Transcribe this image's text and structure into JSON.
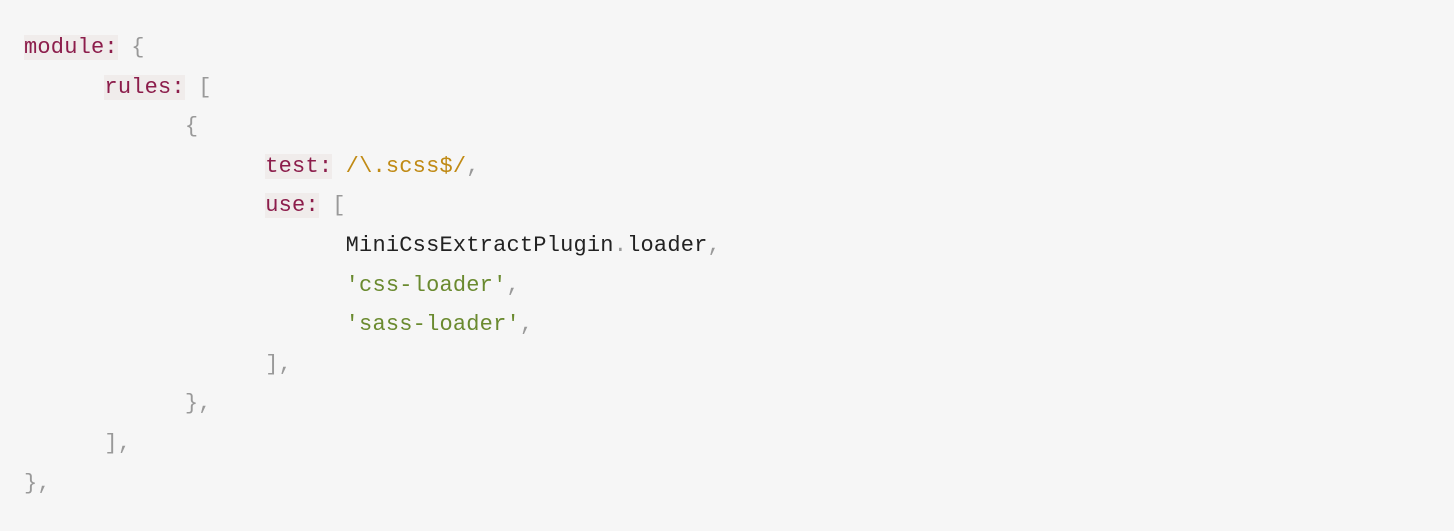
{
  "code": {
    "lines": [
      {
        "indent": 0,
        "tokens": [
          {
            "cls": "key",
            "t": "module:"
          },
          {
            "cls": "text",
            "t": " "
          },
          {
            "cls": "punct",
            "t": "{"
          }
        ]
      },
      {
        "indent": 1,
        "tokens": [
          {
            "cls": "key",
            "t": "rules:"
          },
          {
            "cls": "text",
            "t": " "
          },
          {
            "cls": "punct",
            "t": "["
          }
        ]
      },
      {
        "indent": 2,
        "tokens": [
          {
            "cls": "punct",
            "t": "{"
          }
        ]
      },
      {
        "indent": 3,
        "tokens": [
          {
            "cls": "key",
            "t": "test:"
          },
          {
            "cls": "text",
            "t": " "
          },
          {
            "cls": "regex",
            "t": "/\\.scss$/"
          },
          {
            "cls": "punct",
            "t": ","
          }
        ]
      },
      {
        "indent": 3,
        "tokens": [
          {
            "cls": "key",
            "t": "use:"
          },
          {
            "cls": "text",
            "t": " "
          },
          {
            "cls": "punct",
            "t": "["
          }
        ]
      },
      {
        "indent": 4,
        "tokens": [
          {
            "cls": "text",
            "t": "MiniCssExtractPlugin"
          },
          {
            "cls": "punct",
            "t": "."
          },
          {
            "cls": "text",
            "t": "loader"
          },
          {
            "cls": "punct",
            "t": ","
          }
        ]
      },
      {
        "indent": 4,
        "tokens": [
          {
            "cls": "string",
            "t": "'css-loader'"
          },
          {
            "cls": "punct",
            "t": ","
          }
        ]
      },
      {
        "indent": 4,
        "tokens": [
          {
            "cls": "string",
            "t": "'sass-loader'"
          },
          {
            "cls": "punct",
            "t": ","
          }
        ]
      },
      {
        "indent": 3,
        "tokens": [
          {
            "cls": "punct",
            "t": "],"
          }
        ]
      },
      {
        "indent": 2,
        "tokens": [
          {
            "cls": "punct",
            "t": "},"
          }
        ]
      },
      {
        "indent": 1,
        "tokens": [
          {
            "cls": "punct",
            "t": "],"
          }
        ]
      },
      {
        "indent": 0,
        "tokens": [
          {
            "cls": "punct",
            "t": "},"
          }
        ]
      }
    ],
    "indentUnit": "      "
  }
}
